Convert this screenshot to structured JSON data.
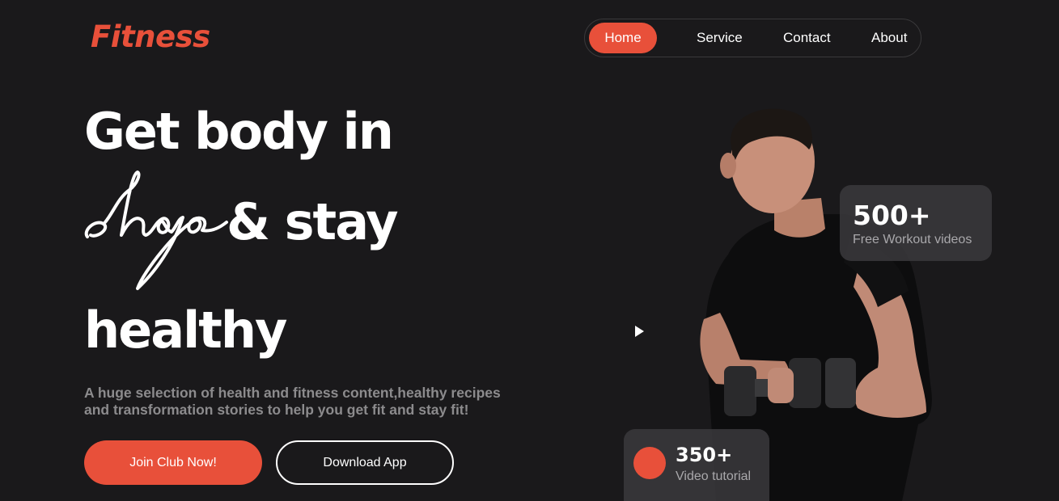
{
  "brand": {
    "logo": "Fitness"
  },
  "nav": {
    "items": [
      {
        "label": "Home",
        "active": true
      },
      {
        "label": "Service"
      },
      {
        "label": "Contact"
      },
      {
        "label": "About"
      }
    ]
  },
  "hero": {
    "line1": "Get body in",
    "script_word": "shape",
    "line2": "& stay",
    "line3": "healthy",
    "description": "A huge selection of health and fitness content,healthy recipes and transformation stories to help you get fit and stay fit!",
    "join_button": "Join Club Now!",
    "download_button": "Download App"
  },
  "stats": {
    "workouts": {
      "value": "500+",
      "label": "Free Workout videos"
    },
    "tutorials": {
      "value": "350+",
      "label": "Video tutorial"
    }
  },
  "colors": {
    "accent": "#e8503a",
    "background": "#1a191b"
  },
  "icons": {
    "play": "play-icon",
    "figure": "fitness-man-image"
  }
}
